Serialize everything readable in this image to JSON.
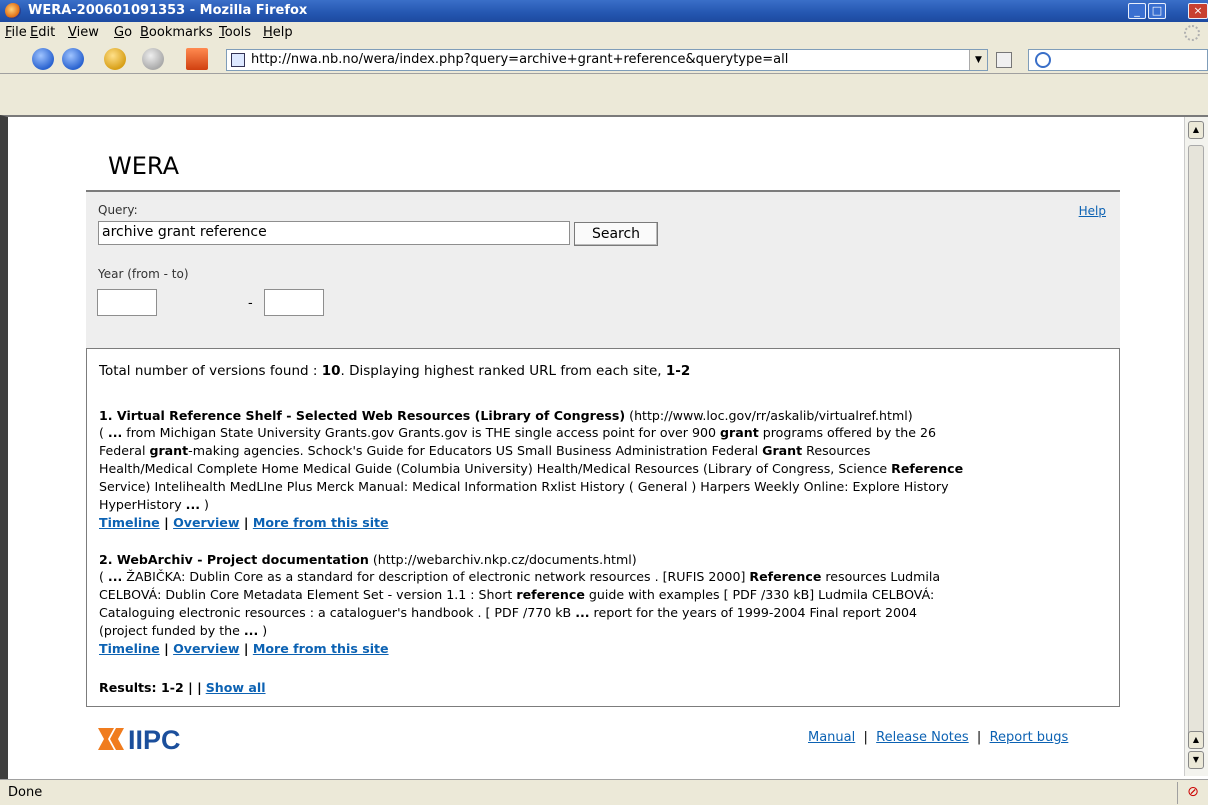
{
  "window": {
    "title": "WERA-200601091353 - Mozilla Firefox",
    "menu": [
      "File",
      "Edit",
      "View",
      "Go",
      "Bookmarks",
      "Tools",
      "Help"
    ],
    "url": "http://nwa.nb.no/wera/index.php?query=archive+grant+reference&querytype=all",
    "status": "Done"
  },
  "page": {
    "logo": "WERA",
    "query_label": "Query:",
    "query_value": "archive grant reference",
    "search_button": "Search",
    "help_link": "Help",
    "year_label": "Year (from - to)",
    "year_dash": "-",
    "summary": {
      "prefix": "Total number of versions found : ",
      "count": "10",
      "middle": ". Displaying highest ranked URL from each site, ",
      "range": "1-2"
    },
    "results": [
      {
        "title": "1. Virtual Reference Shelf - Selected Web Resources (Library of Congress)",
        "url": " (http://www.loc.gov/rr/askalib/virtualref.html)",
        "lines": [
          [
            "( ",
            "b:...",
            " from Michigan State University Grants.gov Grants.gov is THE single access point for over 900 ",
            "b:grant",
            " programs offered by the 26"
          ],
          [
            "Federal ",
            "b:grant",
            "-making agencies. Schock's Guide for Educators US Small Business Administration Federal ",
            "b:Grant",
            " Resources"
          ],
          [
            "Health/Medical Complete Home Medical Guide (Columbia University) Health/Medical Resources (Library of Congress, Science ",
            "b:Reference"
          ],
          [
            "Service) Intelihealth MedLIne Plus Merck Manual: Medical Information Rxlist History ( General ) Harpers Weekly Online: Explore History"
          ],
          [
            "HyperHistory ",
            "b:...",
            " )"
          ]
        ],
        "links": [
          "Timeline",
          "Overview",
          "More from this site"
        ]
      },
      {
        "title": "2. WebArchiv - Project documentation",
        "url": " (http://webarchiv.nkp.cz/documents.html)",
        "lines": [
          [
            "( ",
            "b:...",
            " ŽABIČKA: Dublin Core as a standard for description of electronic network resources . [RUFIS 2000] ",
            "b:Reference",
            " resources Ludmila"
          ],
          [
            "CELBOVÁ: Dublin Core Metadata Element Set - version 1.1 : Short ",
            "b:reference",
            " guide with examples [ PDF /330 kB] Ludmila CELBOVÁ:"
          ],
          [
            "Cataloguing electronic resources : a cataloguer's handbook . [ PDF /770 kB ",
            "b:...",
            " report for the years of 1999-2004 Final report 2004"
          ],
          [
            "(project funded by the ",
            "b:...",
            " )"
          ]
        ],
        "links": [
          "Timeline",
          "Overview",
          "More from this site"
        ]
      }
    ],
    "results_footer": {
      "label": "Results: 1-2 | |",
      "show_all": "Show all"
    },
    "footer_logo_text": "IIPC",
    "footer_links": [
      "Manual",
      "Release Notes",
      "Report bugs"
    ]
  },
  "colors": {
    "link": "#0c62b3",
    "titlebar": "#2456b0",
    "panel": "#eeeeee",
    "iipc_orange": "#f07c1e",
    "iipc_blue": "#1b4f9c"
  }
}
